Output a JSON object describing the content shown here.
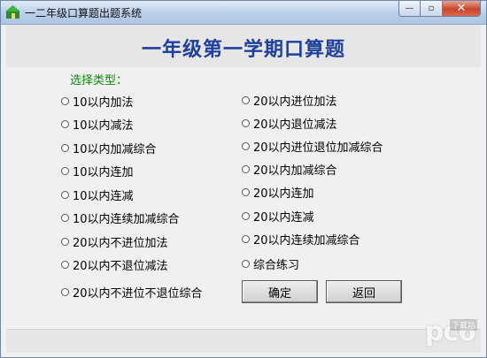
{
  "window": {
    "title": "一二年级口算题出题系统",
    "controls": {
      "minimize": "—",
      "restore": "▫",
      "close": "✕"
    }
  },
  "header": {
    "title": "一年级第一学期口算题"
  },
  "form": {
    "type_label": "选择类型：",
    "left_options": [
      "10以内加法",
      "10以内减法",
      "10以内加减综合",
      "10以内连加",
      "10以内连减",
      "10以内连续加减综合",
      "20以内不进位加法",
      "20以内不退位减法",
      "20以内不进位不退位综合"
    ],
    "right_options": [
      "20以内进位加法",
      "20以内退位减法",
      "20以内进位退位加减综合",
      "20以内加减综合",
      "20以内连加",
      "20以内连减",
      "20以内连续加减综合",
      "综合练习"
    ],
    "confirm_label": "确定",
    "back_label": "返回"
  },
  "watermark": {
    "logo": "pc6",
    "sub": "下载站"
  }
}
